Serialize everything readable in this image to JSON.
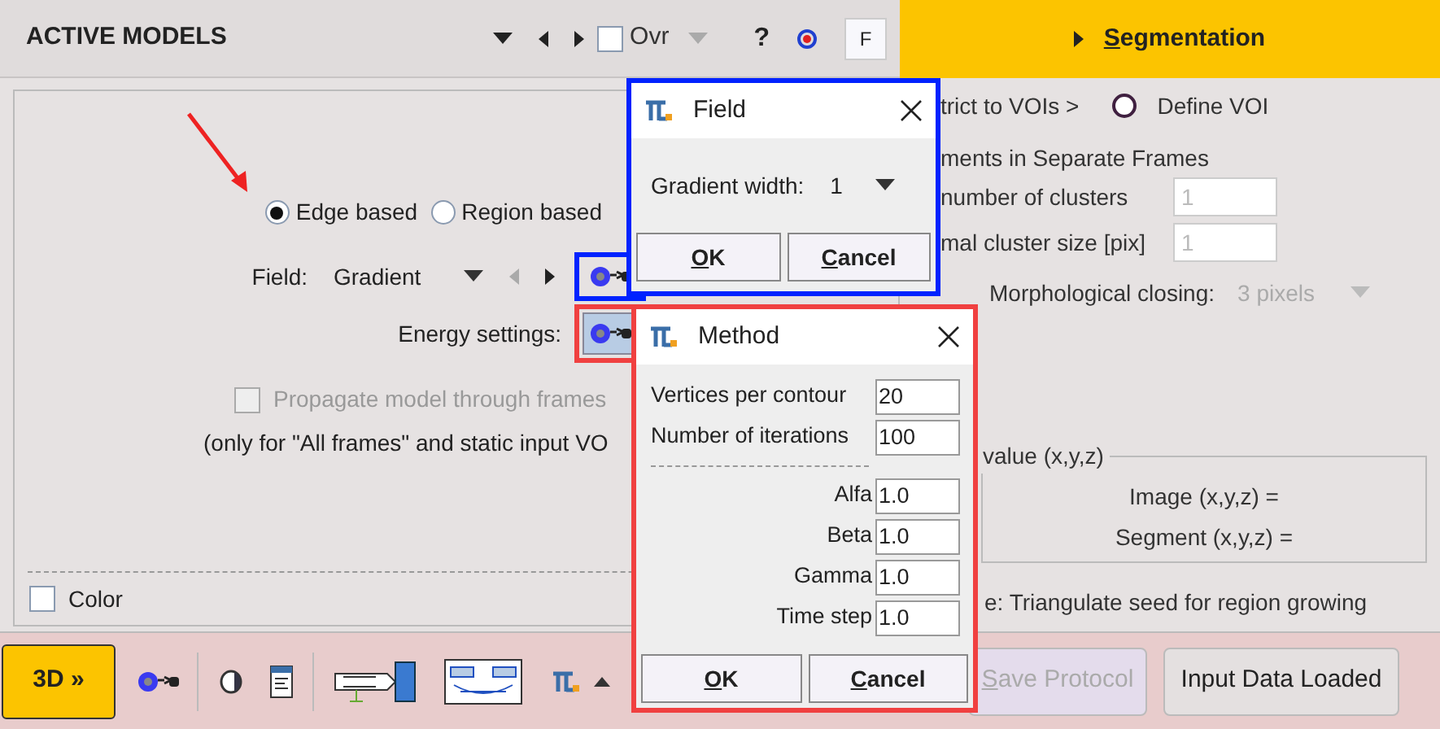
{
  "header": {
    "title": "ACTIVE MODELS",
    "overlay": {
      "label": "Ovr",
      "checked": false
    },
    "help": "?",
    "f_button": "F",
    "tab": {
      "label": "Segmentation",
      "selected": true
    }
  },
  "model_type": [
    {
      "label": "Edge based",
      "selected": true
    },
    {
      "label": "Region based",
      "selected": false
    }
  ],
  "field": {
    "label": "Field:",
    "value": "Gradient"
  },
  "energy": {
    "label": "Energy settings:"
  },
  "propagate": {
    "label": "Propagate model through frames",
    "checked": false,
    "disabled": true
  },
  "note": "(only for \"All frames\" and static input VO",
  "color_option": {
    "label": "Color",
    "checked": false
  },
  "right_panel": {
    "restrict": "trict to VOIs >",
    "define_voi": "Define VOI",
    "separate_frames": "ments in Separate Frames",
    "clusters": {
      "label": "number of clusters",
      "value": "1",
      "disabled": true
    },
    "cluster_size": {
      "label": "mal cluster size [pix]",
      "value": "1",
      "disabled": true
    },
    "closing": {
      "label": "Morphological closing:",
      "value": "3 pixels"
    },
    "value_group": {
      "title": "value (x,y,z)",
      "image": "Image (x,y,z) =",
      "segment": "Segment (x,y,z) ="
    },
    "triangulate": "e: Triangulate seed for region growing"
  },
  "field_dialog": {
    "title": "Field",
    "gradient_width": {
      "label": "Gradient width:",
      "value": "1"
    },
    "buttons": [
      "OK",
      "Cancel"
    ]
  },
  "method_dialog": {
    "title": "Method",
    "param_groups": [
      [
        {
          "label": "Vertices per contour",
          "value": "20"
        },
        {
          "label": "Number of iterations",
          "value": "100"
        }
      ],
      [
        {
          "label": "Alfa",
          "value": "1.0"
        },
        {
          "label": "Beta",
          "value": "1.0"
        },
        {
          "label": "Gamma",
          "value": "1.0"
        },
        {
          "label": "Time step",
          "value": "1.0"
        }
      ]
    ],
    "buttons": [
      "OK",
      "Cancel"
    ]
  },
  "toolbar": {
    "button_3d": "3D »",
    "save_protocol": {
      "label": "Save Protocol",
      "disabled": true
    },
    "input_data": "Input Data Loaded"
  }
}
